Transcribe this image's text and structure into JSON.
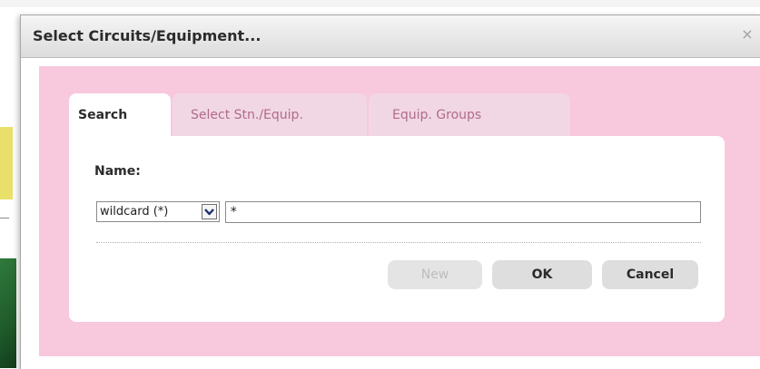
{
  "dialog": {
    "title": "Select Circuits/Equipment...",
    "close_glyph": "×"
  },
  "tabs": [
    {
      "label": "Search",
      "active": true
    },
    {
      "label": "Select Stn./Equip.",
      "active": false
    },
    {
      "label": "Equip. Groups",
      "active": false
    }
  ],
  "search": {
    "name_label": "Name:",
    "match_mode": "wildcard (*)",
    "query_value": "*"
  },
  "buttons": {
    "new_label": "New",
    "ok_label": "OK",
    "cancel_label": "Cancel"
  },
  "colors": {
    "pink_background": "#f8c8dd",
    "inactive_tab": "#f1d7e3",
    "inactive_tab_text": "#b06b8c"
  }
}
